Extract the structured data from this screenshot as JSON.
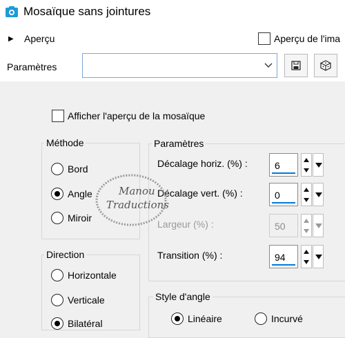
{
  "window": {
    "title": "Mosaïque sans jointures"
  },
  "toolbar": {
    "preview_label": "Aperçu",
    "image_preview_label": "Aperçu de l'ima",
    "params_label": "Paramètres",
    "preset_value": ""
  },
  "options": {
    "preview_mosaic_label": "Afficher l'aperçu de la mosaïque"
  },
  "method": {
    "title": "Méthode",
    "options": [
      {
        "label": "Bord",
        "selected": false
      },
      {
        "label": "Angle",
        "selected": true
      },
      {
        "label": "Miroir",
        "selected": false
      }
    ]
  },
  "direction": {
    "title": "Direction",
    "options": [
      {
        "label": "Horizontale",
        "selected": false
      },
      {
        "label": "Verticale",
        "selected": false
      },
      {
        "label": "Bilatéral",
        "selected": true
      }
    ]
  },
  "parameters": {
    "title": "Paramètres",
    "fields": [
      {
        "label": "Décalage horiz. (%) :",
        "value": "6",
        "enabled": true
      },
      {
        "label": "Décalage vert. (%) :",
        "value": "0",
        "enabled": true
      },
      {
        "label": "Largeur (%) :",
        "value": "50",
        "enabled": false
      },
      {
        "label": "Transition (%) :",
        "value": "94",
        "enabled": true
      }
    ]
  },
  "corner_style": {
    "title": "Style d'angle",
    "options": [
      {
        "label": "Linéaire",
        "selected": true
      },
      {
        "label": "Incurvé",
        "selected": false
      }
    ]
  },
  "watermark": {
    "line1": "Manou",
    "line2": "Traductions"
  },
  "colors": {
    "accent": "#0078d7",
    "icon_blue": "#1e9bd7"
  }
}
